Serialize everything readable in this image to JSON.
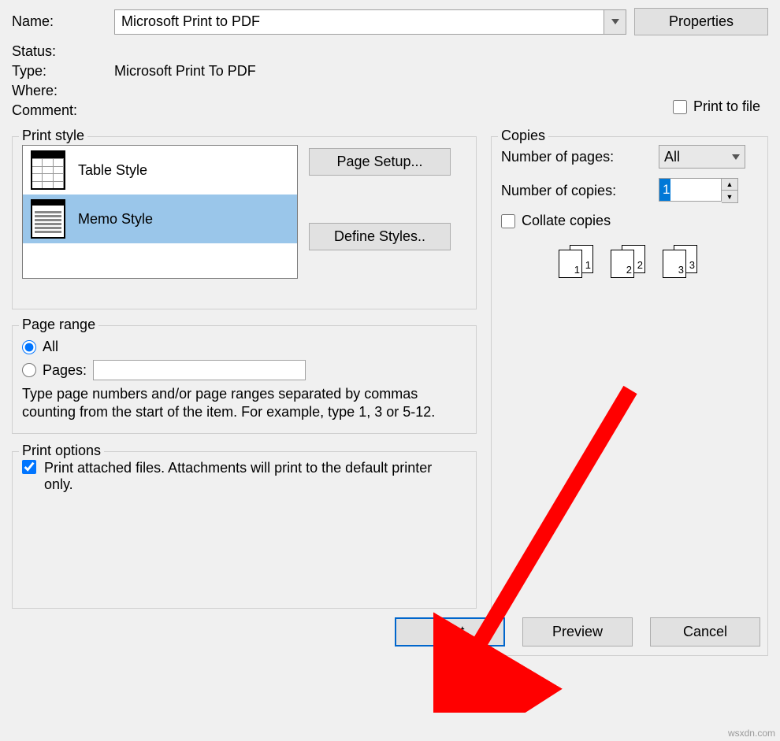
{
  "printer": {
    "name_label": "Name:",
    "name_value": "Microsoft Print to PDF",
    "properties_label": "Properties",
    "status_label": "Status:",
    "status_value": "",
    "type_label": "Type:",
    "type_value": "Microsoft Print To PDF",
    "where_label": "Where:",
    "where_value": "",
    "comment_label": "Comment:",
    "comment_value": "",
    "print_to_file_label": "Print to file"
  },
  "print_style": {
    "legend": "Print style",
    "items": [
      "Table Style",
      "Memo Style"
    ],
    "selected_index": 1,
    "page_setup_label": "Page Setup...",
    "define_styles_label": "Define Styles.."
  },
  "copies": {
    "legend": "Copies",
    "num_pages_label": "Number of pages:",
    "num_pages_value": "All",
    "num_copies_label": "Number of copies:",
    "num_copies_value": "1",
    "collate_label": "Collate copies",
    "groups": [
      [
        "1",
        "1"
      ],
      [
        "2",
        "2"
      ],
      [
        "3",
        "3"
      ]
    ]
  },
  "page_range": {
    "legend": "Page range",
    "all_label": "All",
    "pages_label": "Pages:",
    "help": "Type page numbers and/or page ranges separated by commas counting from the start of the item.  For example, type 1, 3 or 5-12."
  },
  "print_options": {
    "legend": "Print options",
    "attached_label": "Print attached files.  Attachments will print to the default printer only."
  },
  "buttons": {
    "print": "Print",
    "preview": "Preview",
    "cancel": "Cancel"
  },
  "watermark": "wsxdn.com"
}
